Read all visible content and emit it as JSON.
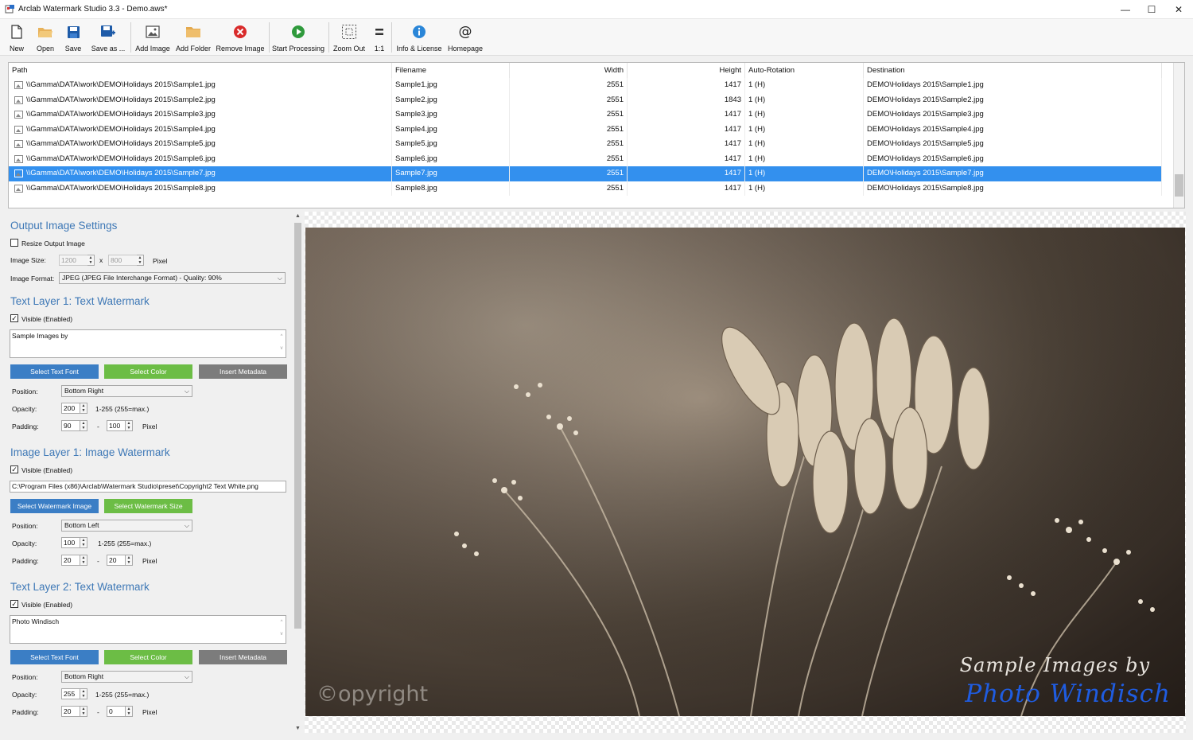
{
  "window": {
    "title": "Arclab Watermark Studio 3.3 - Demo.aws*",
    "minimize": "—",
    "maximize": "☐",
    "close": "✕"
  },
  "toolbar": {
    "new": "New",
    "open": "Open",
    "save": "Save",
    "save_as": "Save as ...",
    "add_image": "Add Image",
    "add_folder": "Add Folder",
    "remove_image": "Remove Image",
    "start_processing": "Start Processing",
    "zoom_out": "Zoom Out",
    "one_to_one": "1:1",
    "info_license": "Info & License",
    "homepage": "Homepage"
  },
  "table": {
    "headers": {
      "path": "Path",
      "filename": "Filename",
      "width": "Width",
      "height": "Height",
      "auto_rotation": "Auto-Rotation",
      "destination": "Destination"
    },
    "rows": [
      {
        "path": "\\\\Gamma\\DATA\\work\\DEMO\\Holidays 2015\\Sample1.jpg",
        "filename": "Sample1.jpg",
        "width": "2551",
        "height": "1417",
        "rotation": "1 (H)",
        "destination": "DEMO\\Holidays 2015\\Sample1.jpg"
      },
      {
        "path": "\\\\Gamma\\DATA\\work\\DEMO\\Holidays 2015\\Sample2.jpg",
        "filename": "Sample2.jpg",
        "width": "2551",
        "height": "1843",
        "rotation": "1 (H)",
        "destination": "DEMO\\Holidays 2015\\Sample2.jpg"
      },
      {
        "path": "\\\\Gamma\\DATA\\work\\DEMO\\Holidays 2015\\Sample3.jpg",
        "filename": "Sample3.jpg",
        "width": "2551",
        "height": "1417",
        "rotation": "1 (H)",
        "destination": "DEMO\\Holidays 2015\\Sample3.jpg"
      },
      {
        "path": "\\\\Gamma\\DATA\\work\\DEMO\\Holidays 2015\\Sample4.jpg",
        "filename": "Sample4.jpg",
        "width": "2551",
        "height": "1417",
        "rotation": "1 (H)",
        "destination": "DEMO\\Holidays 2015\\Sample4.jpg"
      },
      {
        "path": "\\\\Gamma\\DATA\\work\\DEMO\\Holidays 2015\\Sample5.jpg",
        "filename": "Sample5.jpg",
        "width": "2551",
        "height": "1417",
        "rotation": "1 (H)",
        "destination": "DEMO\\Holidays 2015\\Sample5.jpg"
      },
      {
        "path": "\\\\Gamma\\DATA\\work\\DEMO\\Holidays 2015\\Sample6.jpg",
        "filename": "Sample6.jpg",
        "width": "2551",
        "height": "1417",
        "rotation": "1 (H)",
        "destination": "DEMO\\Holidays 2015\\Sample6.jpg"
      },
      {
        "path": "\\\\Gamma\\DATA\\work\\DEMO\\Holidays 2015\\Sample7.jpg",
        "filename": "Sample7.jpg",
        "width": "2551",
        "height": "1417",
        "rotation": "1 (H)",
        "destination": "DEMO\\Holidays 2015\\Sample7.jpg",
        "selected": true
      },
      {
        "path": "\\\\Gamma\\DATA\\work\\DEMO\\Holidays 2015\\Sample8.jpg",
        "filename": "Sample8.jpg",
        "width": "2551",
        "height": "1417",
        "rotation": "1 (H)",
        "destination": "DEMO\\Holidays 2015\\Sample8.jpg"
      }
    ]
  },
  "output": {
    "heading": "Output Image Settings",
    "resize_label": "Resize Output Image",
    "resize_checked": false,
    "size_label": "Image Size:",
    "width_value": "1200",
    "x": "x",
    "height_value": "800",
    "unit": "Pixel",
    "format_label": "Image Format:",
    "format_value": "JPEG (JPEG File Interchange Format) - Quality: 90%"
  },
  "text_layer_1": {
    "heading": "Text Layer 1: Text Watermark",
    "visible_label": "Visible (Enabled)",
    "visible_checked": true,
    "text": "Sample Images by",
    "font_button": "Select Text Font",
    "color_button": "Select Color",
    "metadata_button": "Insert Metadata",
    "position_label": "Position:",
    "position_value": "Bottom Right",
    "opacity_label": "Opacity:",
    "opacity_value": "200",
    "opacity_hint": "1-255 (255=max.)",
    "padding_label": "Padding:",
    "padding_x": "90",
    "dash": "-",
    "padding_y": "100",
    "unit": "Pixel"
  },
  "image_layer_1": {
    "heading": "Image Layer 1: Image Watermark",
    "visible_label": "Visible (Enabled)",
    "visible_checked": true,
    "file_path": "C:\\Program Files (x86)\\Arclab\\Watermark Studio\\preset\\Copyright2 Text White.png",
    "image_button": "Select Watermark Image",
    "size_button": "Select Watermark Size",
    "position_label": "Position:",
    "position_value": "Bottom Left",
    "opacity_label": "Opacity:",
    "opacity_value": "100",
    "opacity_hint": "1-255 (255=max.)",
    "padding_label": "Padding:",
    "padding_x": "20",
    "dash": "-",
    "padding_y": "20",
    "unit": "Pixel"
  },
  "text_layer_2": {
    "heading": "Text Layer 2: Text Watermark",
    "visible_label": "Visible (Enabled)",
    "visible_checked": true,
    "text": "Photo Windisch",
    "font_button": "Select Text Font",
    "color_button": "Select Color",
    "metadata_button": "Insert Metadata",
    "position_label": "Position:",
    "position_value": "Bottom Right",
    "opacity_label": "Opacity:",
    "opacity_value": "255",
    "opacity_hint": "1-255 (255=max.)",
    "padding_label": "Padding:",
    "padding_x": "20",
    "dash": "-",
    "padding_y": "0",
    "unit": "Pixel"
  },
  "preview": {
    "watermark_copyright": "©opyright",
    "watermark_line1": "Sample Images by",
    "watermark_line2": "Photo Windisch"
  },
  "colors": {
    "accent_blue": "#3b7ec5",
    "button_green": "#6cbd45",
    "button_gray": "#7c7c7c",
    "selection": "#3390ee",
    "section_heading": "#3e78b6",
    "watermark_blue": "#1f5ce0"
  }
}
